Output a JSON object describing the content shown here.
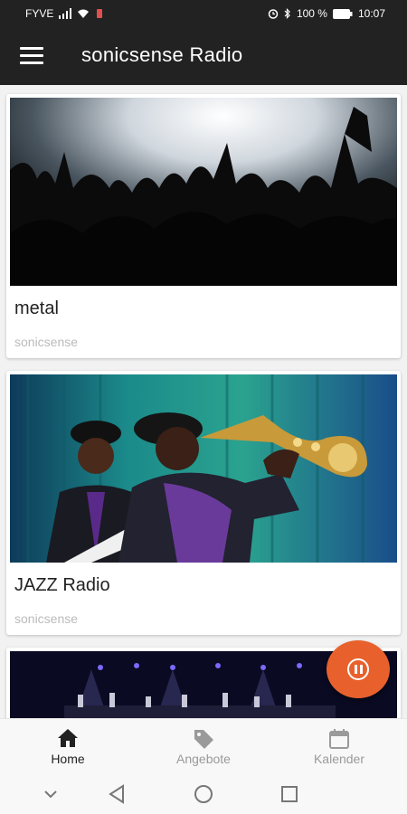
{
  "status_bar": {
    "carrier": "FYVE",
    "battery": "100 %",
    "time": "10:07"
  },
  "app_bar": {
    "title": "sonicsense Radio"
  },
  "stations": [
    {
      "title": "metal",
      "subtitle": "sonicsense",
      "image": "concert-crowd-image"
    },
    {
      "title": "JAZZ Radio",
      "subtitle": "sonicsense",
      "image": "saxophone-player-image"
    },
    {
      "title": "",
      "subtitle": "",
      "image": "orchestra-stage-image"
    }
  ],
  "bottom_nav": [
    {
      "label": "Home",
      "icon": "home-icon",
      "active": true
    },
    {
      "label": "Angebote",
      "icon": "tag-icon",
      "active": false
    },
    {
      "label": "Kalender",
      "icon": "calendar-icon",
      "active": false
    }
  ],
  "colors": {
    "app_bar": "#222222",
    "fab": "#e8612c",
    "active_nav": "#222222",
    "inactive_nav": "#9a9a9a"
  },
  "fab": {
    "icon": "pause-icon"
  }
}
